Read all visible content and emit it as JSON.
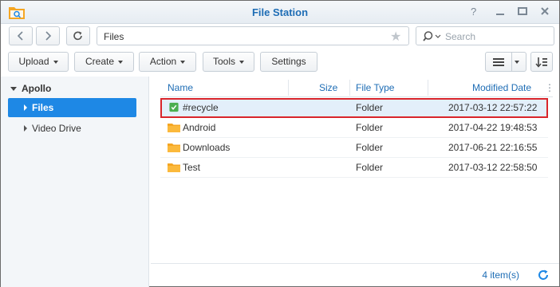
{
  "window": {
    "title": "File Station",
    "controls": [
      "?",
      "_",
      "□",
      "✕"
    ]
  },
  "nav": {
    "path": "Files",
    "search_placeholder": "Search"
  },
  "toolbar": {
    "upload": "Upload",
    "create": "Create",
    "action": "Action",
    "tools": "Tools",
    "settings": "Settings"
  },
  "sidebar": {
    "root": "Apollo",
    "items": [
      {
        "label": "Files",
        "active": true
      },
      {
        "label": "Video Drive",
        "active": false
      }
    ]
  },
  "columns": {
    "name": "Name",
    "size": "Size",
    "file_type": "File Type",
    "modified": "Modified Date"
  },
  "files": [
    {
      "name": "#recycle",
      "size": "",
      "type": "Folder",
      "modified": "2017-03-12 22:57:22",
      "icon": "recycle-bin-icon",
      "selected": true
    },
    {
      "name": "Android",
      "size": "",
      "type": "Folder",
      "modified": "2017-04-22 19:48:53",
      "icon": "folder-icon",
      "selected": false
    },
    {
      "name": "Downloads",
      "size": "",
      "type": "Folder",
      "modified": "2017-06-21 22:16:55",
      "icon": "folder-icon",
      "selected": false
    },
    {
      "name": "Test",
      "size": "",
      "type": "Folder",
      "modified": "2017-03-12 22:58:50",
      "icon": "folder-icon",
      "selected": false
    }
  ],
  "status": {
    "count": "4 item(s)"
  },
  "colors": {
    "accent": "#1e88e5",
    "title": "#1e6db5",
    "highlight_border": "#d9252b",
    "folder": "#f5a623"
  }
}
